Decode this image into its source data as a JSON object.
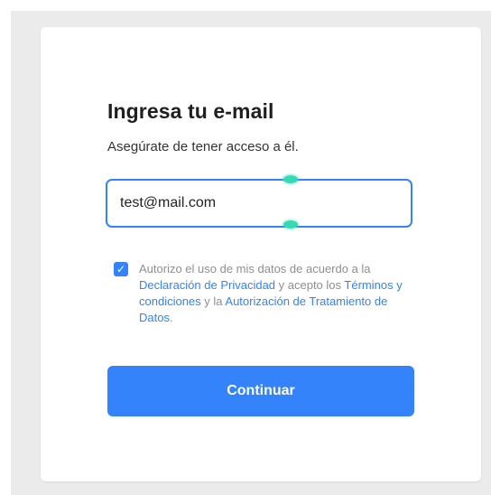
{
  "form": {
    "title": "Ingresa tu e-mail",
    "subtitle": "Asegúrate de tener acceso a él.",
    "email_value": "test@mail.com",
    "consent": {
      "checked": true,
      "text_1": "Autorizo el uso de mis datos de acuerdo a la ",
      "link_privacy": "Declaración de Privacidad",
      "text_2": " y acepto los ",
      "link_terms": "Términos y condiciones",
      "text_3": " y la ",
      "link_authorization": "Autorización de Tratamiento de Datos",
      "text_4": "."
    },
    "continue_label": "Continuar"
  },
  "colors": {
    "accent": "#3483fa",
    "handle": "#35d9b4",
    "background": "#ebebeb"
  },
  "icons": {
    "checkbox": "check-icon"
  }
}
